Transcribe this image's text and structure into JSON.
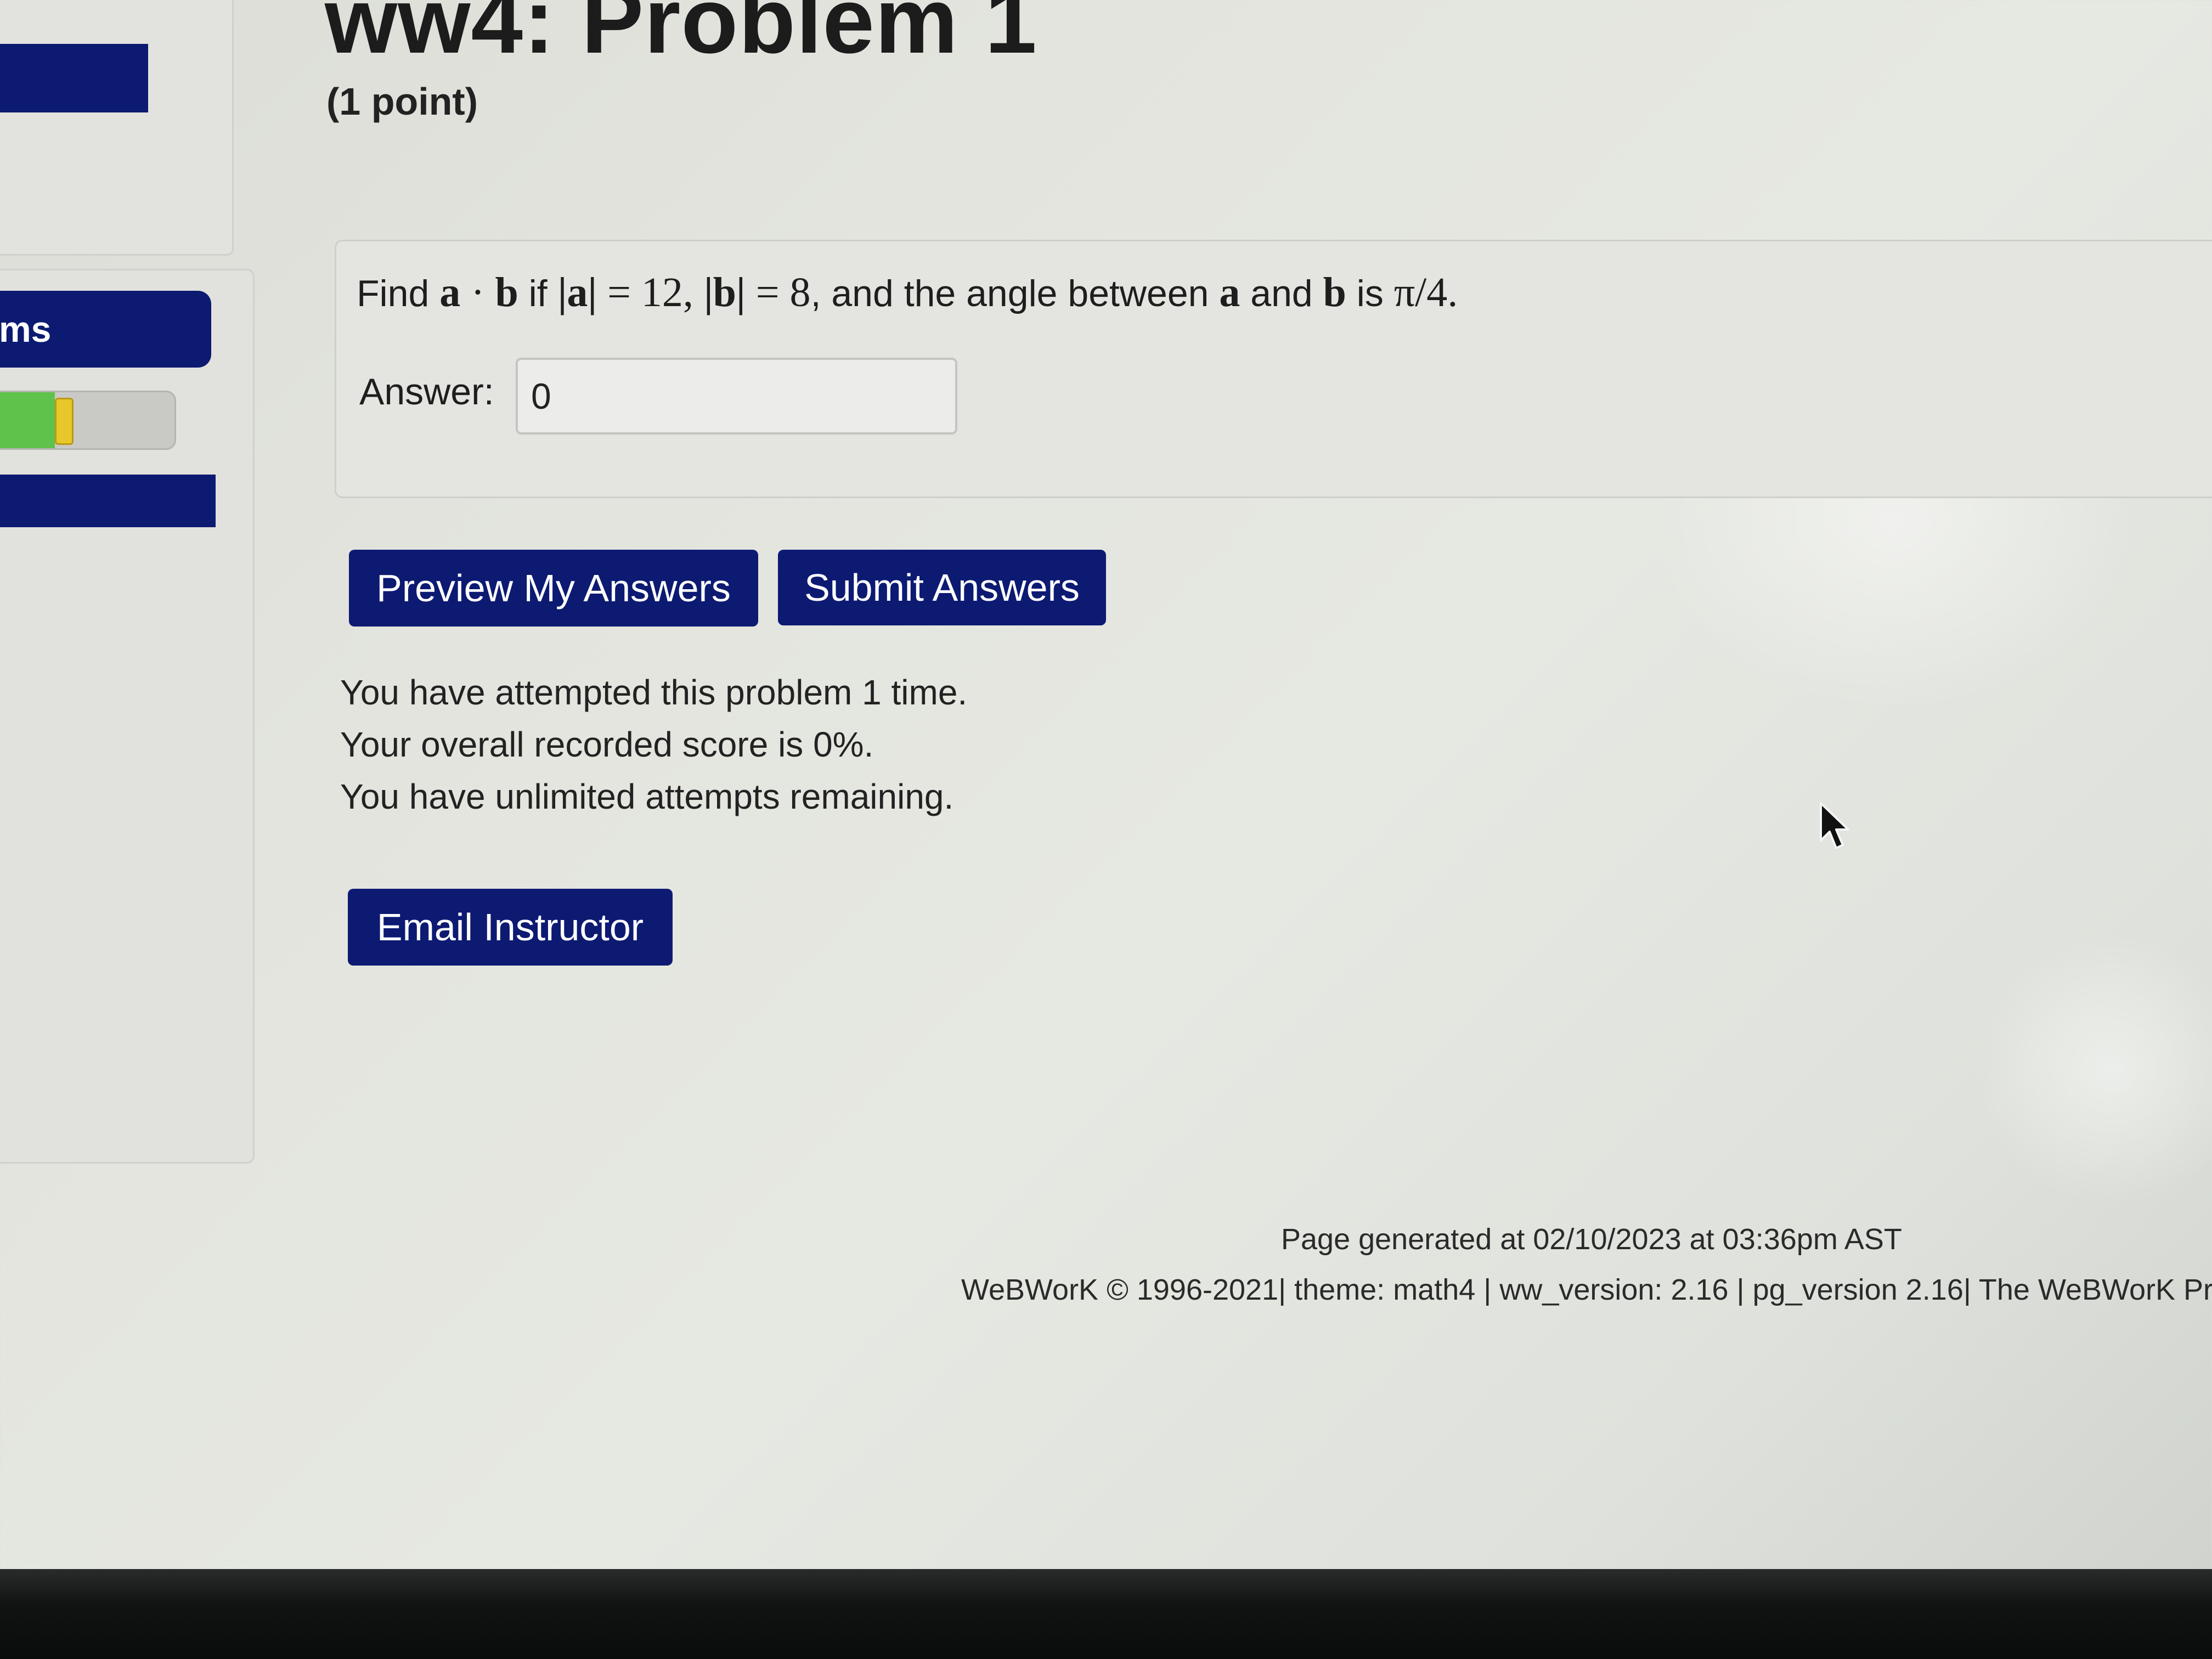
{
  "header": {
    "title": "ww4: Problem 1",
    "points": "(1 point)"
  },
  "sidebar": {
    "nav_label": "ms",
    "progress": {
      "colors": [
        "#5fc24a",
        "#e8c72a"
      ]
    }
  },
  "problem": {
    "text_parts": {
      "find": "Find ",
      "a": "a",
      "dot": " · ",
      "b": "b",
      "if": " if ",
      "abs_a": "|a|",
      "eq12": " = 12, ",
      "abs_b": "|b|",
      "eq8": " = 8",
      "angle_text": ", and the angle between ",
      "a2": "a",
      "and": " and ",
      "b2": "b",
      "is": " is ",
      "angle": "π/4",
      "period": "."
    },
    "answer_label": "Answer:",
    "answer_value": "0"
  },
  "buttons": {
    "preview": "Preview My Answers",
    "submit": "Submit Answers",
    "email": "Email Instructor"
  },
  "attempts": {
    "line1": "You have attempted this problem 1 time.",
    "line2": "Your overall recorded score is 0%.",
    "line3": "You have unlimited attempts remaining."
  },
  "footer": {
    "generated": "Page generated at 02/10/2023 at 03:36pm AST",
    "version": "WeBWorK © 1996-2021| theme: math4 | ww_version: 2.16 | pg_version 2.16| The WeBWorK Project"
  },
  "colors": {
    "primary": "#0c1a72",
    "panel": "#e4e5e0"
  }
}
